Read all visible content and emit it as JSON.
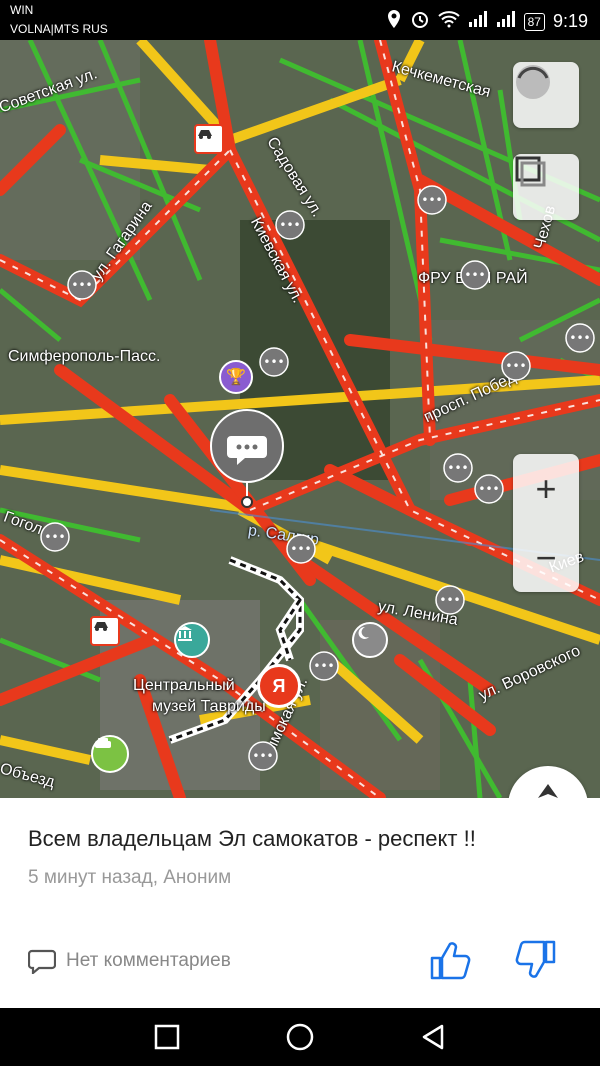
{
  "status_bar": {
    "carrier_line1": "WIN",
    "carrier_line2": "VOLNA|MTS RUS",
    "battery": "87",
    "time": "9:19"
  },
  "map": {
    "labels": {
      "station": "Симферополь-Пасс.",
      "gagarina": "ул. Гагарина",
      "kievskaya": "Киевская ул.",
      "sadovaya": "Садовая ул.",
      "kechkemetskaya": "Кечкеметская",
      "fruit_area": "ФРУ   ВЫЙ РАЙ",
      "pobedy": "просп. Победы",
      "salgir": "р. Салгир",
      "lenina": "ул. Ленина",
      "vorovskogo": "ул. Воровского",
      "gogol": "Гогол",
      "museum_line1": "Центральный",
      "museum_line2": "музей Тавриды",
      "obezd": "Объезд",
      "kiev_short": "Киев",
      "krymskaya": "Крымская ул.",
      "chekhov": "Чехов",
      "sovetskaya": "Советская ул."
    },
    "colors": {
      "jam": "#e8391c",
      "slow": "#f2c619",
      "free": "#3fbf2f"
    }
  },
  "zoom": {
    "plus": "+",
    "minus": "−"
  },
  "card": {
    "title": "Всем владельцам Эл самокатов - респект !!",
    "meta": "5 минут назад, Аноним",
    "comments": "Нет комментариев"
  }
}
